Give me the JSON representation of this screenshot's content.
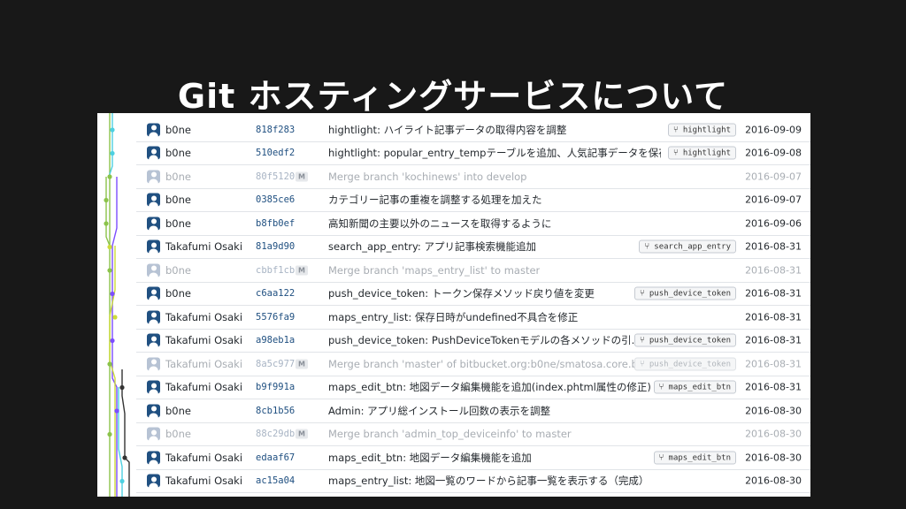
{
  "title": "Git ホスティングサービスについて",
  "colors": {
    "background": "#181818",
    "hash": "#205081",
    "graph_lines": [
      "#4dd0e1",
      "#8bc34a",
      "#cddc39",
      "#7c4dff",
      "#333333"
    ]
  },
  "commits": [
    {
      "author": "b0ne",
      "hash": "818f283",
      "message": "hightlight: ハイライト記事データの取得内容を調整",
      "branch": "hightlight",
      "date": "2016-09-09",
      "merge": false
    },
    {
      "author": "b0ne",
      "hash": "510edf2",
      "message": "hightlight: popular_entry_tempテーブルを追加、人気記事データを保存...",
      "branch": "hightlight",
      "date": "2016-09-08",
      "merge": false
    },
    {
      "author": "b0ne",
      "hash": "80f5120",
      "message": "Merge branch 'kochinews' into develop",
      "branch": "",
      "date": "2016-09-07",
      "merge": true
    },
    {
      "author": "b0ne",
      "hash": "0385ce6",
      "message": "カテゴリー記事の重複を調整する処理を加えた",
      "branch": "",
      "date": "2016-09-07",
      "merge": false
    },
    {
      "author": "b0ne",
      "hash": "b8fb0ef",
      "message": "高知新聞の主要以外のニュースを取得するように",
      "branch": "",
      "date": "2016-09-06",
      "merge": false
    },
    {
      "author": "Takafumi Osaki",
      "hash": "81a9d90",
      "message": "search_app_entry: アプリ記事検索機能追加",
      "branch": "search_app_entry",
      "date": "2016-08-31",
      "merge": false
    },
    {
      "author": "b0ne",
      "hash": "cbbf1cb",
      "message": "Merge branch 'maps_entry_list' to master",
      "branch": "",
      "date": "2016-08-31",
      "merge": true
    },
    {
      "author": "b0ne",
      "hash": "c6aa122",
      "message": "push_device_token: トークン保存メソッド戻り値を変更",
      "branch": "push_device_token",
      "date": "2016-08-31",
      "merge": false
    },
    {
      "author": "Takafumi Osaki",
      "hash": "5576fa9",
      "message": "maps_entry_list: 保存日時がundefined不具合を修正",
      "branch": "",
      "date": "2016-08-31",
      "merge": false
    },
    {
      "author": "Takafumi Osaki",
      "hash": "a98eb1a",
      "message": "push_device_token: PushDeviceTokenモデルの各メソッドの引...",
      "branch": "push_device_token",
      "date": "2016-08-31",
      "merge": false
    },
    {
      "author": "Takafumi Osaki",
      "hash": "8a5c977",
      "message": "Merge branch 'master' of bitbucket.org:b0ne/smatosa.core.back...",
      "branch": "push_device_token",
      "date": "2016-08-31",
      "merge": true
    },
    {
      "author": "Takafumi Osaki",
      "hash": "b9f991a",
      "message": "maps_edit_btn: 地図データ編集機能を追加(index.phtml属性の修正)",
      "branch": "maps_edit_btn",
      "date": "2016-08-31",
      "merge": false
    },
    {
      "author": "b0ne",
      "hash": "8cb1b56",
      "message": "Admin: アプリ総インストール回数の表示を調整",
      "branch": "",
      "date": "2016-08-30",
      "merge": false
    },
    {
      "author": "b0ne",
      "hash": "88c29db",
      "message": "Merge branch 'admin_top_deviceinfo' to master",
      "branch": "",
      "date": "2016-08-30",
      "merge": true
    },
    {
      "author": "Takafumi Osaki",
      "hash": "edaaf67",
      "message": "maps_edit_btn: 地図データ編集機能を追加",
      "branch": "maps_edit_btn",
      "date": "2016-08-30",
      "merge": false
    },
    {
      "author": "Takafumi Osaki",
      "hash": "ac15a04",
      "message": "maps_entry_list: 地図一覧のワードから記事一覧を表示する（完成）",
      "branch": "",
      "date": "2016-08-30",
      "merge": false
    }
  ]
}
